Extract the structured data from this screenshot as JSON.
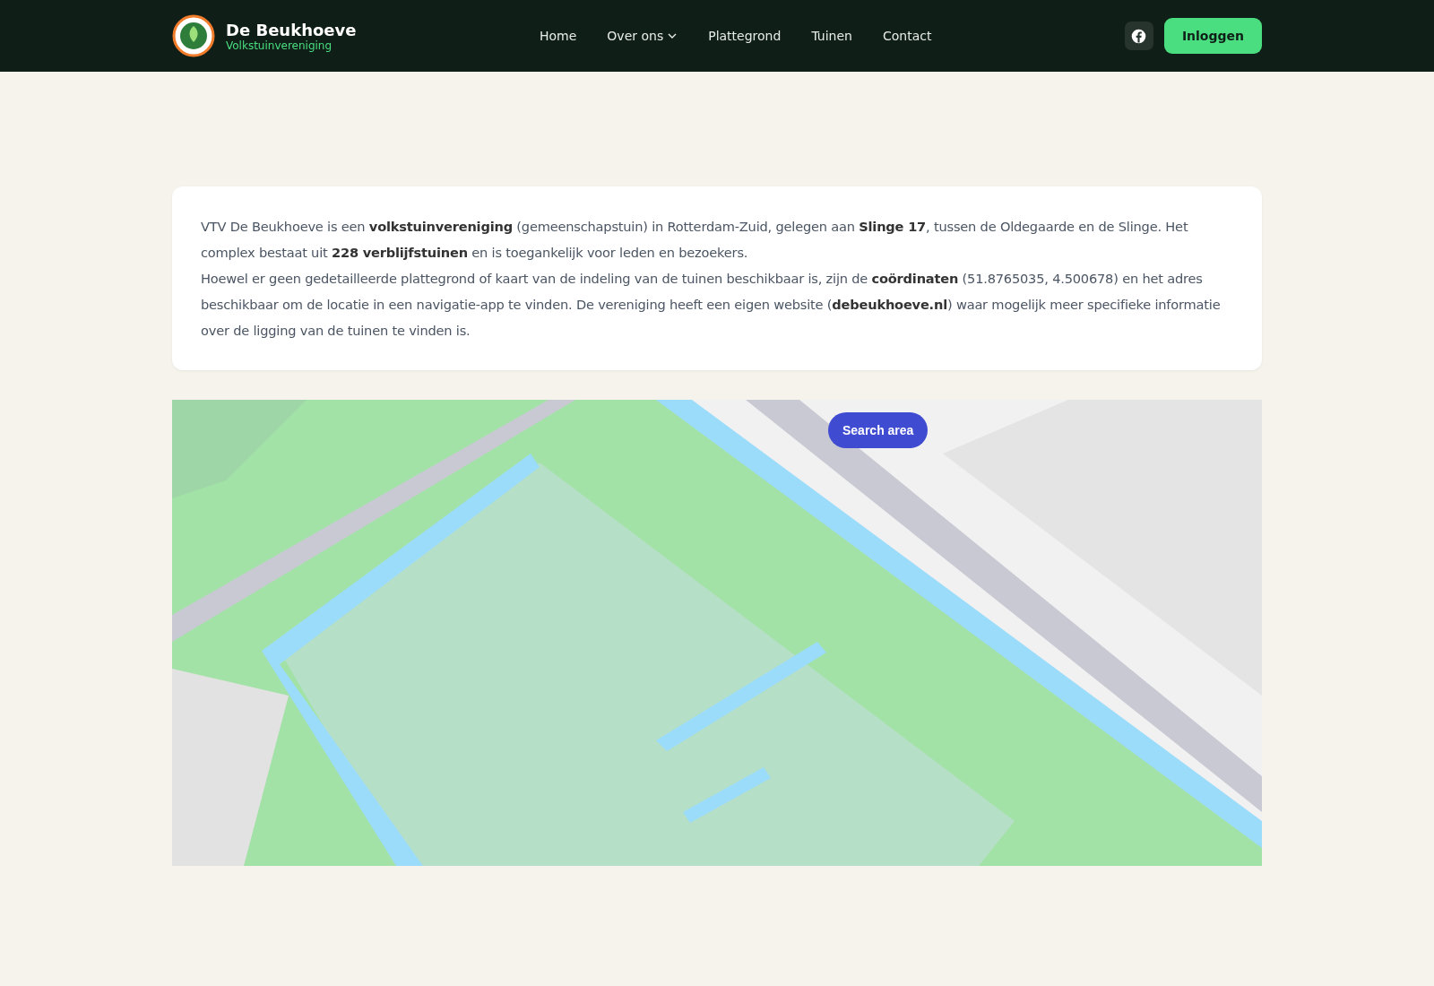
{
  "header": {
    "brand": {
      "name": "De Beukhoeve",
      "tagline": "Volkstuinvereniging"
    },
    "nav": [
      {
        "label": "Home",
        "has_menu": false
      },
      {
        "label": "Over ons",
        "has_menu": true
      },
      {
        "label": "Plattegrond",
        "has_menu": false
      },
      {
        "label": "Tuinen",
        "has_menu": false
      },
      {
        "label": "Contact",
        "has_menu": false
      }
    ],
    "login_button": "Inloggen"
  },
  "intro": {
    "paragraphs": [
      "VTV De Beukhoeve is een **volkstuinvereniging** (gemeenschapstuin) in Rotterdam-Zuid, gelegen aan **Slinge 17**, tussen de Oldegaarde en de Slinge. Het complex bestaat uit **228 verblijfstuinen** en is toegankelijk voor leden en bezoekers.",
      "Hoewel er geen gedetailleerde plattegrond of kaart van de indeling van de tuinen beschikbaar is, zijn de **coördinaten** (51.8765035, 4.500678) en het adres beschikbaar om de locatie in een navigatie-app te vinden. De vereniging heeft een eigen website (**debeukhoeve.nl**) waar mogelijk meer specifieke informatie over de ligging van de tuinen te vinden is."
    ]
  },
  "map": {
    "search_button": "Search area"
  }
}
